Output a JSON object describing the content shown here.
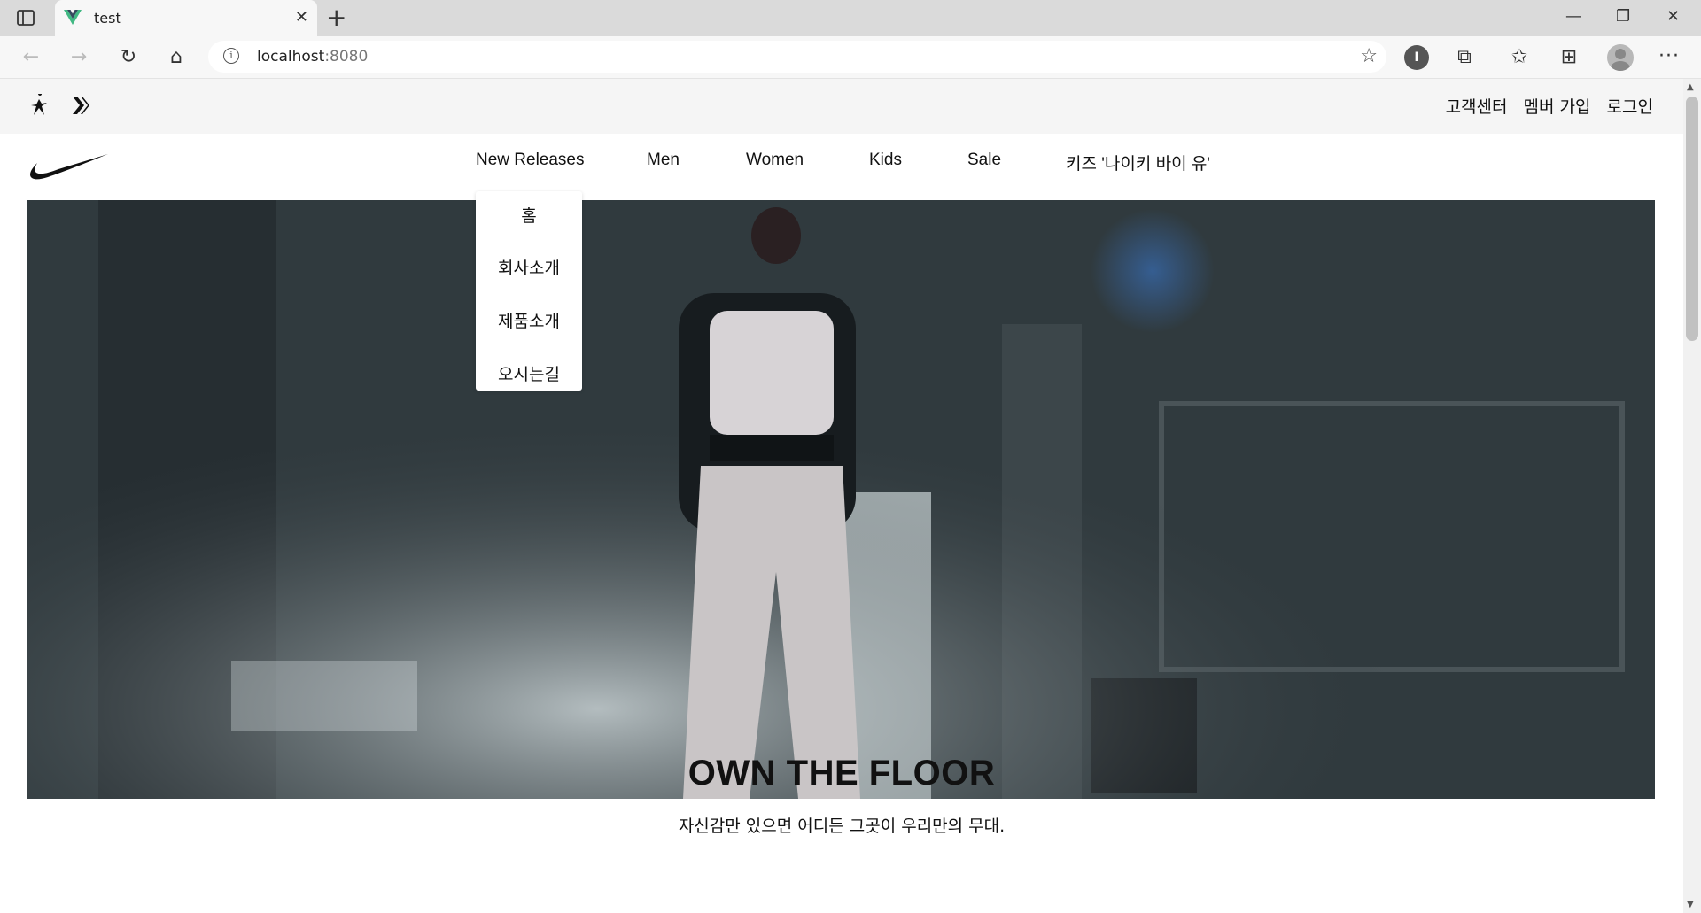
{
  "browser": {
    "tab_title": "test",
    "url_host": "localhost",
    "url_port": ":8080",
    "icons": {
      "sidebar": "tab-actions-icon",
      "favicon": "vue-logo-icon",
      "close": "close-icon",
      "new_tab": "plus-icon",
      "minimize": "minimize-icon",
      "restore": "restore-icon",
      "window_close": "close-icon",
      "back": "arrow-left-icon",
      "forward": "arrow-right-icon",
      "refresh": "refresh-icon",
      "home": "home-icon",
      "info": "info-icon",
      "add_favorite": "star-plus-icon",
      "reader": "reader-extension-icon",
      "extensions": "puzzle-icon",
      "favorites": "favorites-icon",
      "collections": "collections-icon",
      "profile": "profile-icon",
      "more": "more-icon"
    }
  },
  "utility": {
    "brands": [
      "jordan-logo-icon",
      "converse-logo-icon"
    ],
    "links": [
      "고객센터",
      "멤버 가입",
      "로그인"
    ]
  },
  "nav": {
    "logo": "nike-swoosh-icon",
    "items": [
      "New Releases",
      "Men",
      "Women",
      "Kids",
      "Sale",
      "키즈 '나이키 바이 유'"
    ]
  },
  "dropdown": {
    "items": [
      "홈",
      "회사소개",
      "제품소개",
      "오시는길"
    ]
  },
  "hero": {
    "headline": "OWN THE FLOOR",
    "subline": "자신감만 있으면 어디든 그곳이 우리만의 무대."
  },
  "colors": {
    "accent_text": "#111111",
    "utility_bg": "#f5f5f5",
    "hero_bg": "#2c3438"
  }
}
